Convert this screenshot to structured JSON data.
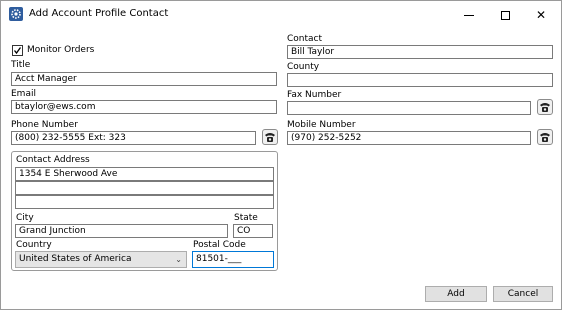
{
  "window": {
    "title": "Add Account Profile Contact",
    "controls": {
      "minimize_icon": "minimize-icon",
      "maximize_icon": "maximize-icon",
      "close_glyph": "✕"
    }
  },
  "left": {
    "monitor_orders": {
      "label": "Monitor Orders",
      "checked": true
    },
    "title_label": "Title",
    "title_value": "Acct Manager",
    "email_label": "Email",
    "email_value": "btaylor@ews.com",
    "phone_label": "Phone Number",
    "phone_value": "(800) 232-5555 Ext: 323"
  },
  "address": {
    "group_label": "Contact Address",
    "line1": "1354 E Sherwood Ave",
    "line2": "",
    "line3": "",
    "city_label": "City",
    "city_value": "Grand Junction",
    "state_label": "State",
    "state_value": "CO",
    "country_label": "Country",
    "country_value": "United States of America",
    "postal_label": "Postal Code",
    "postal_value": "81501-___"
  },
  "right": {
    "contact_label": "Contact",
    "contact_value": "Bill Taylor",
    "county_label": "County",
    "county_value": "",
    "fax_label": "Fax Number",
    "fax_value": "",
    "mobile_label": "Mobile Number",
    "mobile_value": "(970) 252-5252"
  },
  "buttons": {
    "add": "Add",
    "cancel": "Cancel"
  },
  "icons": {
    "app": "gear-icon",
    "phone": "telephone-icon"
  }
}
